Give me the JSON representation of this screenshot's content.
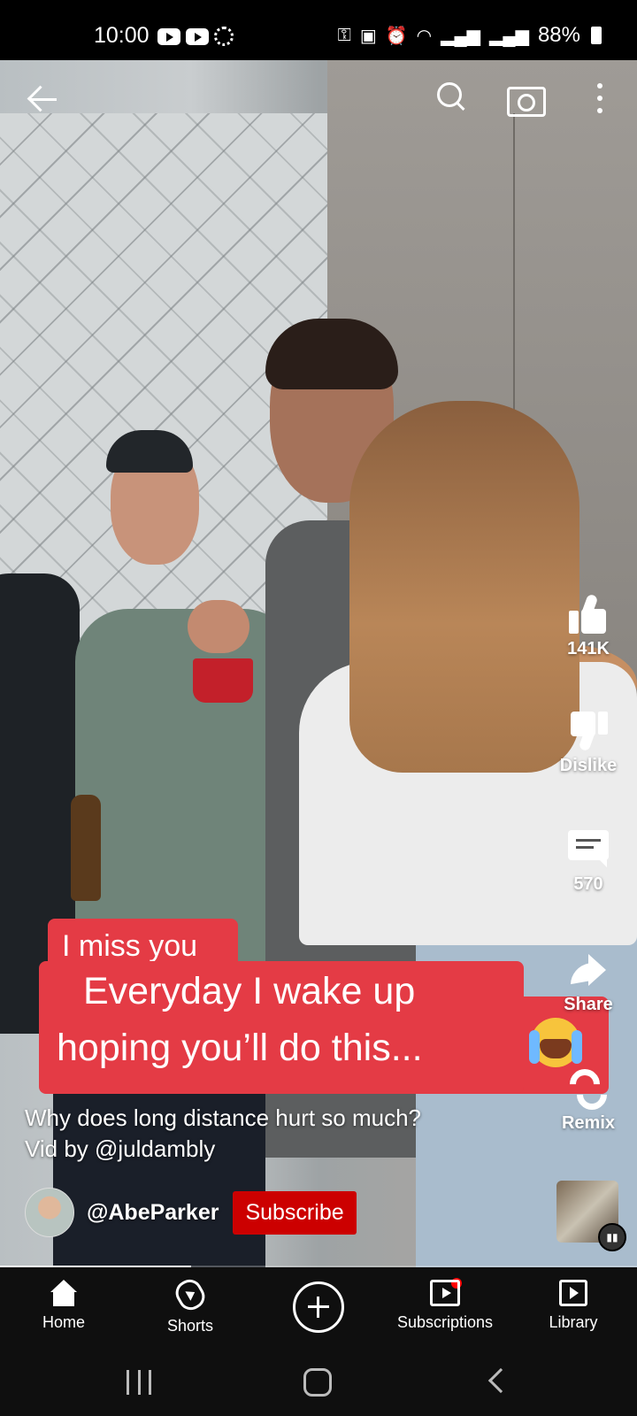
{
  "status_bar": {
    "time": "10:00",
    "battery": "88%",
    "icons": [
      "youtube-icon",
      "youtube-icon",
      "loading-icon",
      "key-icon",
      "battery-saver-icon",
      "alarm-icon",
      "wifi-icon",
      "signal-icon",
      "signal-icon",
      "battery-icon"
    ]
  },
  "top_controls": {
    "icons": [
      "back-arrow-icon",
      "search-icon",
      "camera-icon",
      "more-vert-icon"
    ]
  },
  "video_captions": {
    "line_small": "I miss you",
    "line_big_1": "Everyday I wake up",
    "line_big_2": "hoping you’ll do this...",
    "emoji": "crying-face-emoji",
    "caption_color": "#e43b45"
  },
  "actions": {
    "like_count": "141K",
    "dislike_label": "Dislike",
    "comment_count": "570",
    "share_label": "Share",
    "remix_label": "Remix"
  },
  "description": {
    "line1": "Why does long distance hurt so much?",
    "line2": "Vid by @juldambly"
  },
  "channel": {
    "name": "@AbeParker",
    "subscribe_label": "Subscribe",
    "subscribe_color": "#cc0000"
  },
  "progress": 0.3,
  "bottom_nav": {
    "items": [
      {
        "label": "Home",
        "icon": "home-icon"
      },
      {
        "label": "Shorts",
        "icon": "shorts-icon"
      },
      {
        "label": "",
        "icon": "create-plus-icon"
      },
      {
        "label": "Subscriptions",
        "icon": "subscriptions-icon"
      },
      {
        "label": "Library",
        "icon": "library-icon"
      }
    ]
  },
  "system_nav": {
    "icons": [
      "recent-apps-icon",
      "home-button-icon",
      "back-icon"
    ]
  }
}
